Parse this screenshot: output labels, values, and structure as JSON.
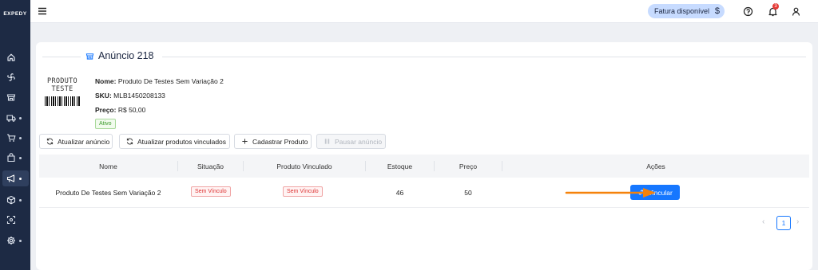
{
  "sidebar": {
    "logo": "EXPEDY",
    "items": [
      {
        "icon": "home-icon",
        "has_dot": false,
        "active": false
      },
      {
        "icon": "fan-icon",
        "has_dot": false,
        "active": false
      },
      {
        "icon": "store-icon",
        "has_dot": false,
        "active": false
      },
      {
        "icon": "truck-icon",
        "has_dot": true,
        "active": false
      },
      {
        "icon": "cart-icon",
        "has_dot": true,
        "active": false
      },
      {
        "icon": "bag-icon",
        "has_dot": true,
        "active": false
      },
      {
        "icon": "megaphone-icon",
        "has_dot": true,
        "active": true
      },
      {
        "icon": "box-icon",
        "has_dot": true,
        "active": false
      },
      {
        "icon": "scan-icon",
        "has_dot": false,
        "active": false
      },
      {
        "icon": "gear-icon",
        "has_dot": true,
        "active": false
      }
    ]
  },
  "topbar": {
    "fatura_label": "Fatura disponível",
    "fatura_symbol": "$",
    "notification_count": "3"
  },
  "listing": {
    "title": "Anúncio 218",
    "thumbnail_text_line1": "PRODUTO",
    "thumbnail_text_line2": "TESTE",
    "nome_label": "Nome:",
    "nome_value": "Produto De Testes Sem Variação 2",
    "sku_label": "SKU:",
    "sku_value": "MLB1450208133",
    "preco_label": "Preço:",
    "preco_value": "R$ 50,00",
    "status": "Ativo"
  },
  "actions": {
    "atualizar_anuncio": "Atualizar anúncio",
    "atualizar_vinculados": "Atualizar produtos vinculados",
    "cadastrar_produto": "Cadastrar Produto",
    "pausar_anuncio": "Pausar anúncio"
  },
  "table": {
    "headers": [
      "Nome",
      "Situação",
      "Produto Vinculado",
      "Estoque",
      "Preço",
      "Ações"
    ],
    "rows": [
      {
        "nome": "Produto De Testes Sem Variação 2",
        "situacao": "Sem Vínculo",
        "produto_vinculado": "Sem Vínculo",
        "estoque": "46",
        "preco": "50",
        "acao": "Vincular"
      }
    ]
  },
  "pagination": {
    "prev": "‹",
    "current": "1",
    "next": "›"
  },
  "colors": {
    "sidebar_bg": "#1d2a44",
    "primary": "#1677ff",
    "arrow": "#f5820b",
    "badge_red": "#e53935"
  }
}
